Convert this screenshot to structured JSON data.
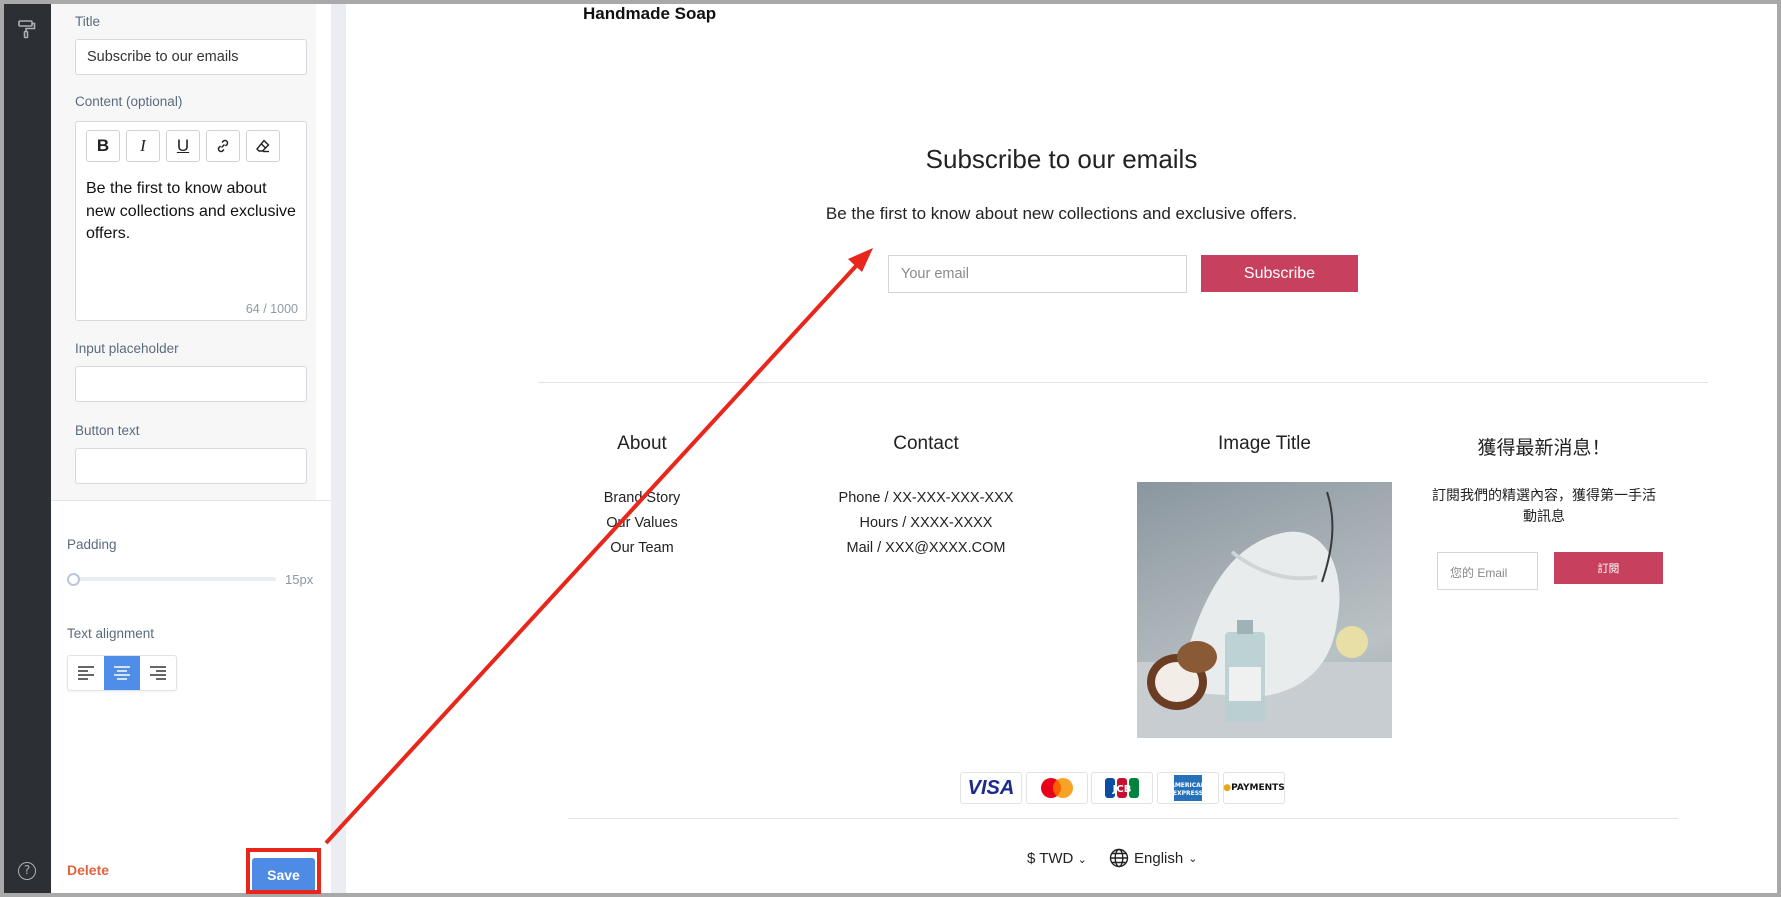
{
  "editor": {
    "title_label": "Title",
    "title_value": "Subscribe to our emails",
    "content_label": "Content (optional)",
    "toolbar": [
      "B",
      "I",
      "U"
    ],
    "content_value": "Be the first to know about new collections and exclusive offers.",
    "char_count": "64 / 1000",
    "placeholder_label": "Input placeholder",
    "placeholder_value": "",
    "button_text_label": "Button text",
    "button_text_value": "",
    "padding_label": "Padding",
    "padding_value": "15px",
    "alignment_label": "Text alignment",
    "alignment_selected": "center",
    "delete_label": "Delete",
    "save_label": "Save"
  },
  "preview": {
    "brand": "Handmade Soap",
    "subscribe_title": "Subscribe to our emails",
    "subscribe_text": "Be the first to know about new collections and exclusive offers.",
    "email_placeholder": "Your email",
    "subscribe_button": "Subscribe",
    "about": {
      "title": "About",
      "links": [
        "Brand Story",
        "Our Values",
        "Our Team"
      ]
    },
    "contact": {
      "title": "Contact",
      "lines": [
        "Phone / XX-XXX-XXX-XXX",
        "Hours / XXXX-XXXX",
        "Mail / XXX@XXXX.COM"
      ]
    },
    "image_title": "Image Title",
    "news": {
      "title": "獲得最新消息！",
      "text": "訂閱我們的精選內容，獲得第一手活動訊息",
      "email_placeholder": "您的 Email",
      "button": "訂閱"
    },
    "payments": [
      "VISA",
      "Mastercard",
      "JCB",
      "AMEX",
      "PAYMENTS"
    ],
    "currency": "$ TWD",
    "language": "English"
  },
  "colors": {
    "accent": "#c7405e",
    "save_blue": "#4d8be5",
    "annotation_red": "#e8261b"
  }
}
